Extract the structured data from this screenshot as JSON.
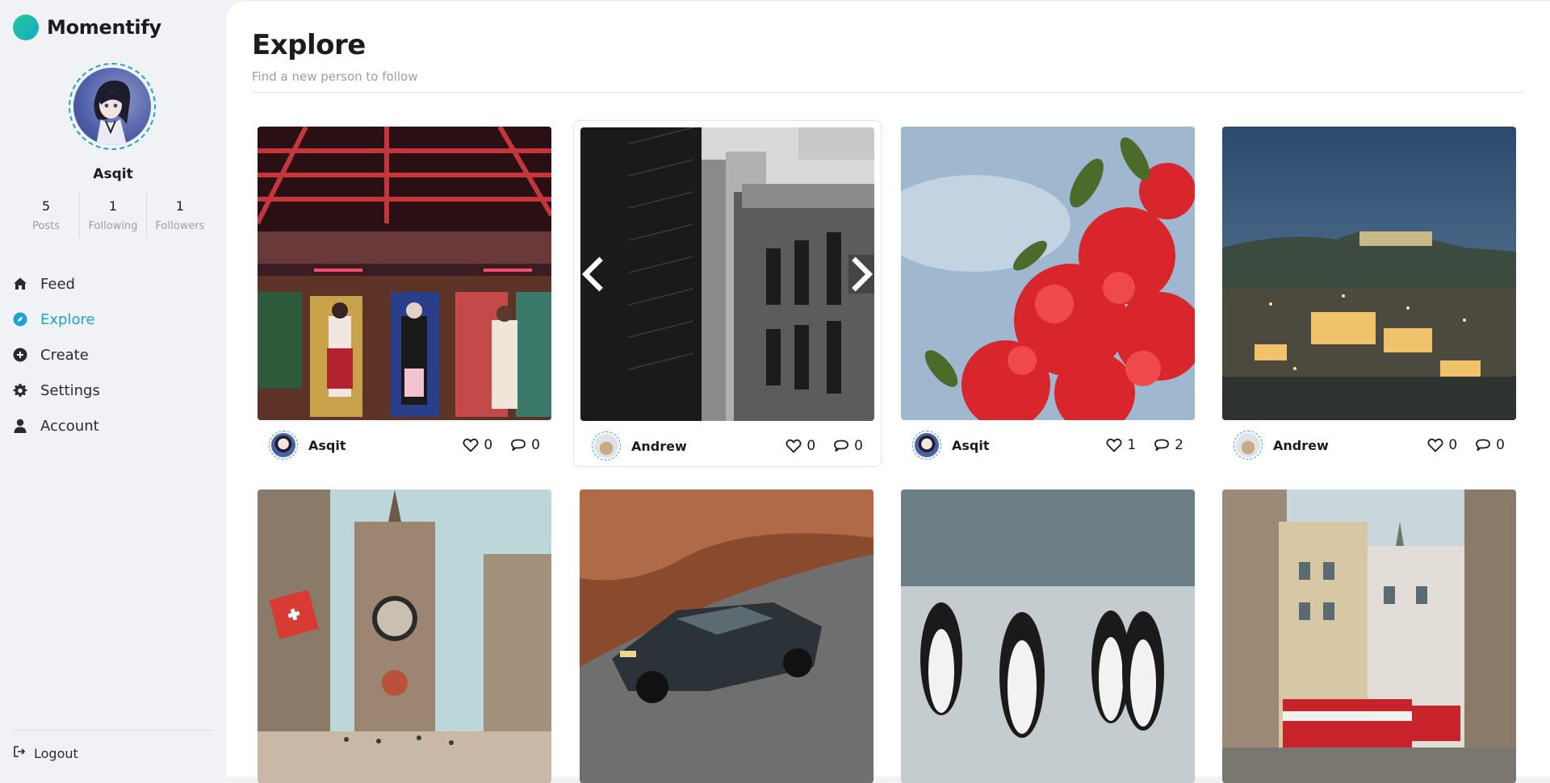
{
  "app": {
    "name": "Momentify"
  },
  "profile": {
    "name": "Asqit",
    "stats": [
      {
        "value": "5",
        "label": "Posts"
      },
      {
        "value": "1",
        "label": "Following"
      },
      {
        "value": "1",
        "label": "Followers"
      }
    ]
  },
  "nav": [
    {
      "label": "Feed",
      "icon": "home-icon",
      "active": false
    },
    {
      "label": "Explore",
      "icon": "compass-icon",
      "active": true
    },
    {
      "label": "Create",
      "icon": "plus-circle-icon",
      "active": false
    },
    {
      "label": "Settings",
      "icon": "gear-icon",
      "active": false
    },
    {
      "label": "Account",
      "icon": "user-icon",
      "active": false
    }
  ],
  "logout_label": "Logout",
  "page": {
    "title": "Explore",
    "subtitle": "Find a new person to follow"
  },
  "colors": {
    "accent": "#1ba3d6",
    "brand_gradient_start": "#20c997",
    "text": "#1c1c1e",
    "muted": "#9a9ea8"
  },
  "posts": [
    {
      "author": "Asqit",
      "likes": "0",
      "comments": "0",
      "image": "arcade"
    },
    {
      "author": "Andrew",
      "likes": "0",
      "comments": "0",
      "image": "buildings-bw"
    },
    {
      "author": "Asqit",
      "likes": "1",
      "comments": "2",
      "image": "red-flowers"
    },
    {
      "author": "Andrew",
      "likes": "0",
      "comments": "0",
      "image": "city-night"
    },
    {
      "author": "",
      "likes": "",
      "comments": "",
      "image": "clock-tower"
    },
    {
      "author": "",
      "likes": "",
      "comments": "",
      "image": "car"
    },
    {
      "author": "",
      "likes": "",
      "comments": "",
      "image": "penguins"
    },
    {
      "author": "",
      "likes": "",
      "comments": "",
      "image": "tram-street"
    }
  ]
}
